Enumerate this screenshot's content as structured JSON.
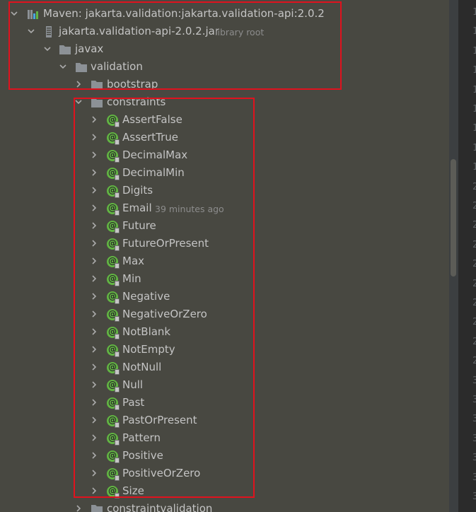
{
  "tree": {
    "maven": "Maven: jakarta.validation:jakarta.validation-api:2.0.2",
    "jar": "jakarta.validation-api-2.0.2.jar",
    "jar_hint": "library root",
    "javax": "javax",
    "validation": "validation",
    "bootstrap": "bootstrap",
    "constraints": "constraints",
    "constraintvalidation": "constraintvalidation",
    "annotations": [
      {
        "label": "AssertFalse",
        "hint": ""
      },
      {
        "label": "AssertTrue",
        "hint": ""
      },
      {
        "label": "DecimalMax",
        "hint": ""
      },
      {
        "label": "DecimalMin",
        "hint": ""
      },
      {
        "label": "Digits",
        "hint": ""
      },
      {
        "label": "Email",
        "hint": "39 minutes ago"
      },
      {
        "label": "Future",
        "hint": ""
      },
      {
        "label": "FutureOrPresent",
        "hint": ""
      },
      {
        "label": "Max",
        "hint": ""
      },
      {
        "label": "Min",
        "hint": ""
      },
      {
        "label": "Negative",
        "hint": ""
      },
      {
        "label": "NegativeOrZero",
        "hint": ""
      },
      {
        "label": "NotBlank",
        "hint": ""
      },
      {
        "label": "NotEmpty",
        "hint": ""
      },
      {
        "label": "NotNull",
        "hint": ""
      },
      {
        "label": "Null",
        "hint": ""
      },
      {
        "label": "Past",
        "hint": ""
      },
      {
        "label": "PastOrPresent",
        "hint": ""
      },
      {
        "label": "Pattern",
        "hint": ""
      },
      {
        "label": "Positive",
        "hint": ""
      },
      {
        "label": "PositiveOrZero",
        "hint": ""
      },
      {
        "label": "Size",
        "hint": ""
      }
    ]
  },
  "gutter": {
    "line_numbers": [
      "1",
      "1",
      "1",
      "1",
      "1",
      "1",
      "1",
      "1",
      "1",
      "2",
      "2",
      "2",
      "2",
      "2",
      "2",
      "2",
      "2",
      "2",
      "2",
      "3",
      "3",
      "3",
      "3",
      "3",
      "3",
      "3"
    ]
  },
  "icons": {
    "annotation_symbol": "@",
    "annotation_color": "#62b543",
    "folder_color": "#8c9196",
    "highlight_color": "#e0121e"
  }
}
